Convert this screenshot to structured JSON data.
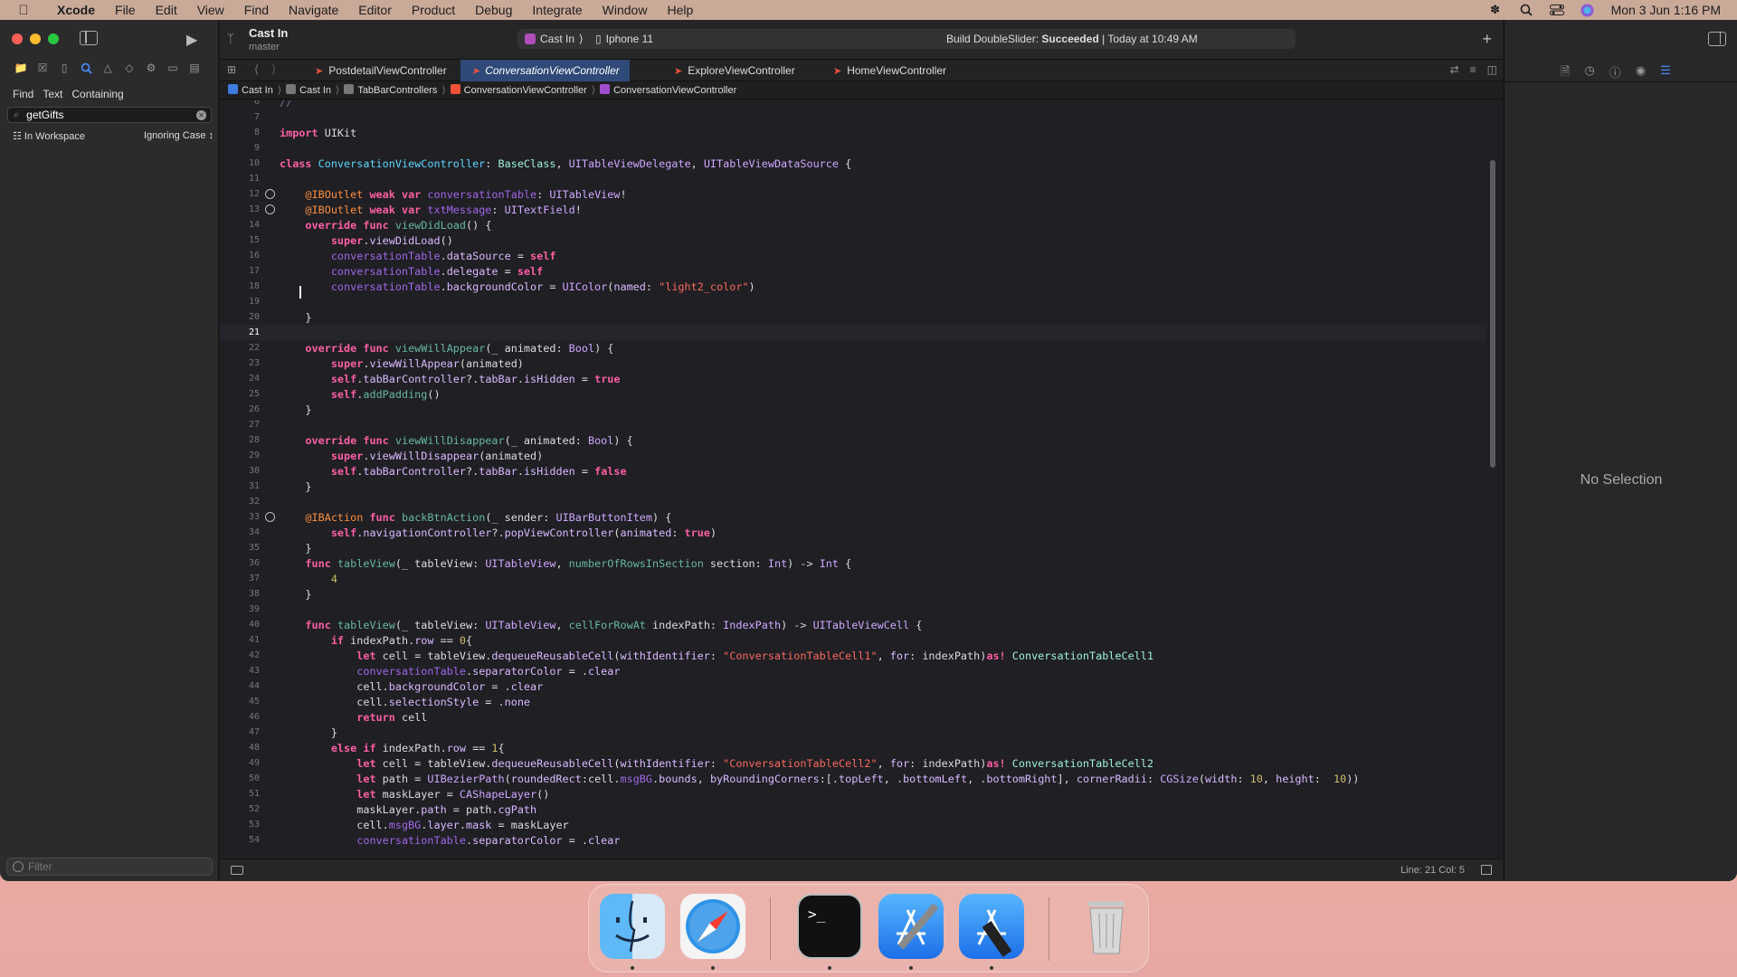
{
  "menubar": {
    "app": "Xcode",
    "items": [
      "File",
      "Edit",
      "View",
      "Find",
      "Navigate",
      "Editor",
      "Product",
      "Debug",
      "Integrate",
      "Window",
      "Help"
    ],
    "datetime": "Mon 3 Jun  1:16 PM"
  },
  "sidebar": {
    "find_mode": [
      "Find",
      "Text",
      "Containing"
    ],
    "search_value": "getGifts",
    "scope": "In Workspace",
    "case_mode": "Ignoring Case ↕",
    "filter_placeholder": "Filter"
  },
  "toolbar": {
    "project": "Cast In",
    "branch": "master",
    "scheme": "Cast In",
    "device": "Iphone 11",
    "build_label": "Build DoubleSlider: ",
    "build_result": "Succeeded",
    "build_time": " | Today at 10:49 AM"
  },
  "tabs": [
    {
      "label": "PostdetailViewController",
      "active": false
    },
    {
      "label": "ConversationViewController",
      "active": true
    },
    {
      "label": "ExploreViewController",
      "active": false
    },
    {
      "label": "HomeViewController",
      "active": false
    }
  ],
  "breadcrumb": [
    "Cast In",
    "Cast In",
    "TabBarControllers",
    "ConversationViewController",
    "ConversationViewController"
  ],
  "editor": {
    "current_line": 21,
    "line_numbers": [
      6,
      7,
      8,
      9,
      10,
      11,
      12,
      13,
      14,
      15,
      16,
      17,
      18,
      19,
      20,
      21,
      22,
      23,
      24,
      25,
      26,
      27,
      28,
      29,
      30,
      31,
      32,
      33,
      34,
      35,
      36,
      37,
      38,
      39,
      40,
      41,
      42,
      43,
      44,
      45,
      46,
      47,
      48,
      49,
      50,
      51,
      52,
      53,
      54
    ],
    "outlet_marker_lines": [
      12,
      13,
      33
    ]
  },
  "status": {
    "line_col": "Line: 21  Col: 5"
  },
  "inspector": {
    "empty_text": "No Selection"
  },
  "dock": [
    "Finder",
    "Safari",
    "Terminal",
    "Xcode",
    "Instruments",
    "Trash"
  ]
}
